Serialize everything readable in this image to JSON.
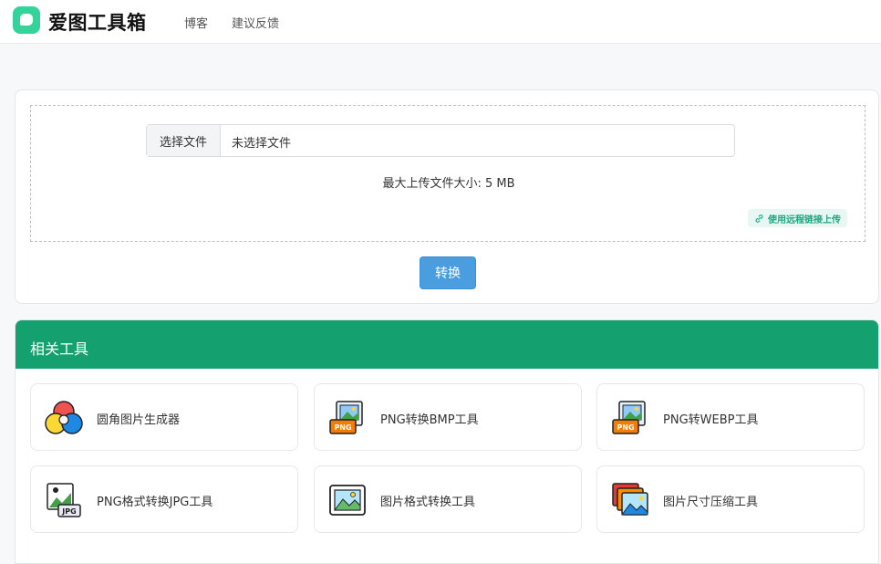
{
  "header": {
    "brand": "爱图工具箱",
    "nav": {
      "blog": "博客",
      "feedback": "建议反馈"
    }
  },
  "upload": {
    "choose_file": "选择文件",
    "no_file": "未选择文件",
    "max_size": "最大上传文件大小: 5 MB",
    "remote_link": "使用远程链接上传",
    "convert": "转换"
  },
  "related": {
    "title": "相关工具",
    "tools": [
      {
        "label": "圆角图片生成器",
        "icon": "color-wheel-icon"
      },
      {
        "label": "PNG转换BMP工具",
        "icon": "png-file-icon"
      },
      {
        "label": "PNG转WEBP工具",
        "icon": "png-file-icon"
      },
      {
        "label": "PNG格式转换JPG工具",
        "icon": "jpg-file-icon"
      },
      {
        "label": "图片格式转换工具",
        "icon": "picture-frame-icon"
      },
      {
        "label": "图片尺寸压缩工具",
        "icon": "stacked-images-icon"
      }
    ],
    "icon_badges": {
      "png": "PNG",
      "jpg": "JPG"
    }
  },
  "colors": {
    "accent": "#14a06f",
    "logo": "#34d399",
    "button": "#4a9ee0"
  }
}
